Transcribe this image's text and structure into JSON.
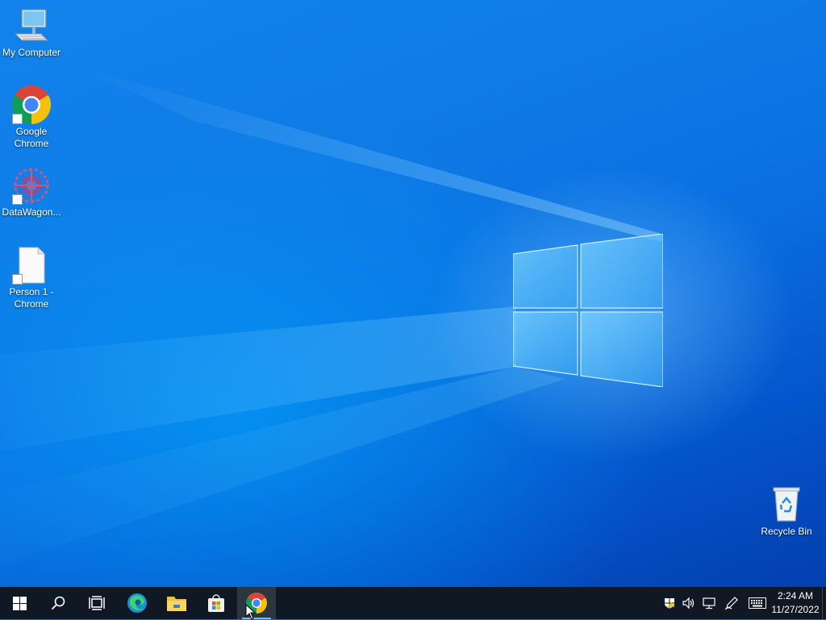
{
  "desktop": {
    "icons": [
      {
        "label": "My Computer",
        "icon": "computer-icon"
      },
      {
        "label": "Google Chrome",
        "icon": "chrome-icon",
        "shortcut": true
      },
      {
        "label": "DataWagon...",
        "icon": "datawagon-icon",
        "shortcut": true
      },
      {
        "label": "Person 1 - Chrome",
        "icon": "blank-document-icon",
        "shortcut": true
      },
      {
        "label": "Recycle Bin",
        "icon": "recycle-bin-icon"
      }
    ],
    "wallpaper": "windows-10-hero",
    "colors": {
      "wallpaper_base": "#0a6fe0",
      "wallpaper_dark": "#033fb0",
      "wallpaper_light": "#1383ec"
    }
  },
  "taskbar": {
    "background": "#101923",
    "items": [
      {
        "name": "start",
        "icon": "windows-start-icon"
      },
      {
        "name": "search",
        "icon": "search-icon"
      },
      {
        "name": "task-view",
        "icon": "task-view-icon"
      },
      {
        "name": "edge",
        "icon": "edge-icon"
      },
      {
        "name": "file-explorer",
        "icon": "folder-icon"
      },
      {
        "name": "microsoft-store",
        "icon": "store-icon"
      },
      {
        "name": "chrome",
        "icon": "chrome-icon",
        "active": true
      }
    ],
    "tray": [
      {
        "name": "security",
        "icon": "shield-warning-icon"
      },
      {
        "name": "volume",
        "icon": "speaker-icon"
      },
      {
        "name": "network",
        "icon": "network-icon"
      },
      {
        "name": "pen",
        "icon": "pen-icon"
      },
      {
        "name": "touch-keyboard",
        "icon": "keyboard-icon"
      }
    ],
    "clock": {
      "time": "2:24 AM",
      "date": "11/27/2022"
    }
  }
}
